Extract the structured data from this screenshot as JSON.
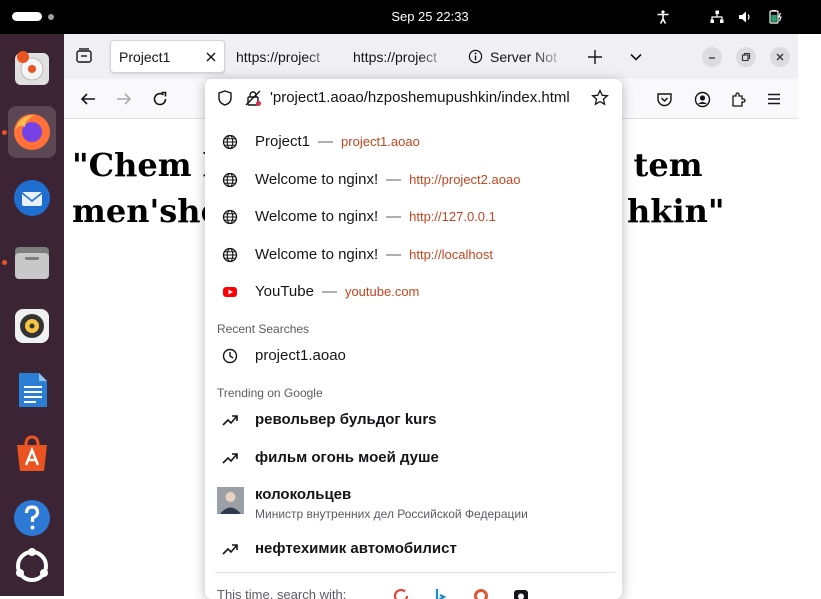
{
  "topbar": {
    "clock": "Sep 25  22:33"
  },
  "dock": {
    "items": [
      {
        "name": "installer"
      },
      {
        "name": "firefox"
      },
      {
        "name": "thunderbird"
      },
      {
        "name": "files"
      },
      {
        "name": "rhythmbox"
      },
      {
        "name": "writer"
      },
      {
        "name": "app-center"
      },
      {
        "name": "help"
      },
      {
        "name": "ubuntu"
      }
    ]
  },
  "browser": {
    "tabs": [
      {
        "label": "Project1"
      },
      {
        "label": "https://project"
      },
      {
        "label": "https://project"
      },
      {
        "label": "Server Not"
      }
    ],
    "url": "'project1.aoao/hzposhemupushkin/index.html"
  },
  "page": {
    "line1_left": "\"Chem b",
    "line1_right": "n, tem",
    "line2_left": "men'she",
    "line2_right": "hkin\""
  },
  "suggestions": [
    {
      "title": "Project1",
      "url": "project1.aoao",
      "icon": "globe-icon"
    },
    {
      "title": "Welcome to nginx!",
      "url": "http://project2.aoao",
      "icon": "globe-icon"
    },
    {
      "title": "Welcome to nginx!",
      "url": "http://127.0.0.1",
      "icon": "globe-icon"
    },
    {
      "title": "Welcome to nginx!",
      "url": "http://localhost",
      "icon": "globe-icon"
    },
    {
      "title": "YouTube",
      "url": "youtube.com",
      "icon": "youtube-icon"
    }
  ],
  "recent": {
    "heading": "Recent Searches",
    "items": [
      "project1.aoao"
    ]
  },
  "trending": {
    "heading": "Trending on Google",
    "items": [
      {
        "title": "револьвер бульдог kurs"
      },
      {
        "title": "фильм огонь моей душе"
      },
      {
        "title": "колокольцев",
        "subtitle": "Министр внутренних дел Российской Федерации"
      },
      {
        "title": "нефтехимик автомобилист"
      }
    ]
  },
  "footer": {
    "search_with": "This time, search with:"
  },
  "separator": "—"
}
